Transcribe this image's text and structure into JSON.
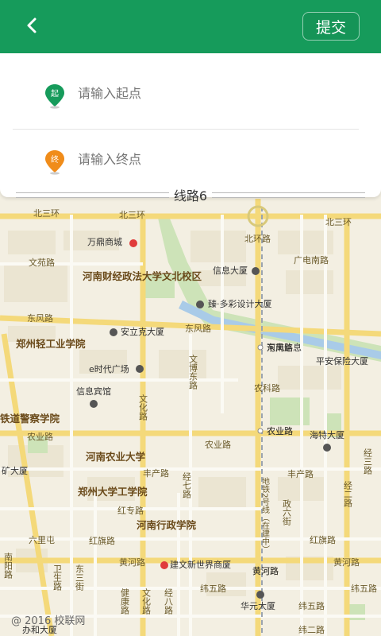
{
  "header": {
    "back_icon": "chevron-left-icon",
    "submit_label": "提交",
    "colors": {
      "bar": "#169b5b",
      "text": "#ffffff"
    }
  },
  "route": {
    "start": {
      "placeholder": "请输入起点",
      "pin_glyph": "起",
      "pin_color": "#169b5b"
    },
    "end": {
      "placeholder": "请输入终点",
      "pin_glyph": "终",
      "pin_color": "#f08c1a"
    },
    "route_name": "线路6"
  },
  "map": {
    "roads": [
      "北三环",
      "北三环",
      "北三环",
      "北环路",
      "东风路",
      "东风路",
      "东风路",
      "农业路",
      "农业路",
      "农业路",
      "丰产路",
      "丰产路",
      "红专路",
      "红旗路",
      "红旗路",
      "黄河路",
      "黄河路",
      "黄河路",
      "纬五路",
      "纬五路",
      "纬五路",
      "纬二路",
      "文苑路",
      "广电南路",
      "文化路",
      "文博东路",
      "农科路",
      "经七路",
      "经二路",
      "经三路",
      "政六街",
      "六里屯",
      "卫生路",
      "东三街",
      "南阳路",
      "健康路",
      "经八路",
      "文化路"
    ],
    "pois": [
      "万鼎商城",
      "河南财经政法大学文北校区",
      "信息大厦",
      "臻·多彩设计大厦",
      "安立克大厦",
      "e时代广场",
      "信息宾馆",
      "郑州轻工业学院",
      "铁道警察学院",
      "河南农业大学",
      "郑州大学工学院",
      "河南行政学院",
      "建文新世界商厦",
      "平安保险大厦",
      "海特大厦",
      "华元大厦",
      "河南信息",
      "东风路",
      "农业路",
      "北环路",
      "黄河路",
      "地铁2号线（在建中）",
      "办和大厦",
      "矿大厦"
    ],
    "copyright": "@ 2016 校联网"
  }
}
